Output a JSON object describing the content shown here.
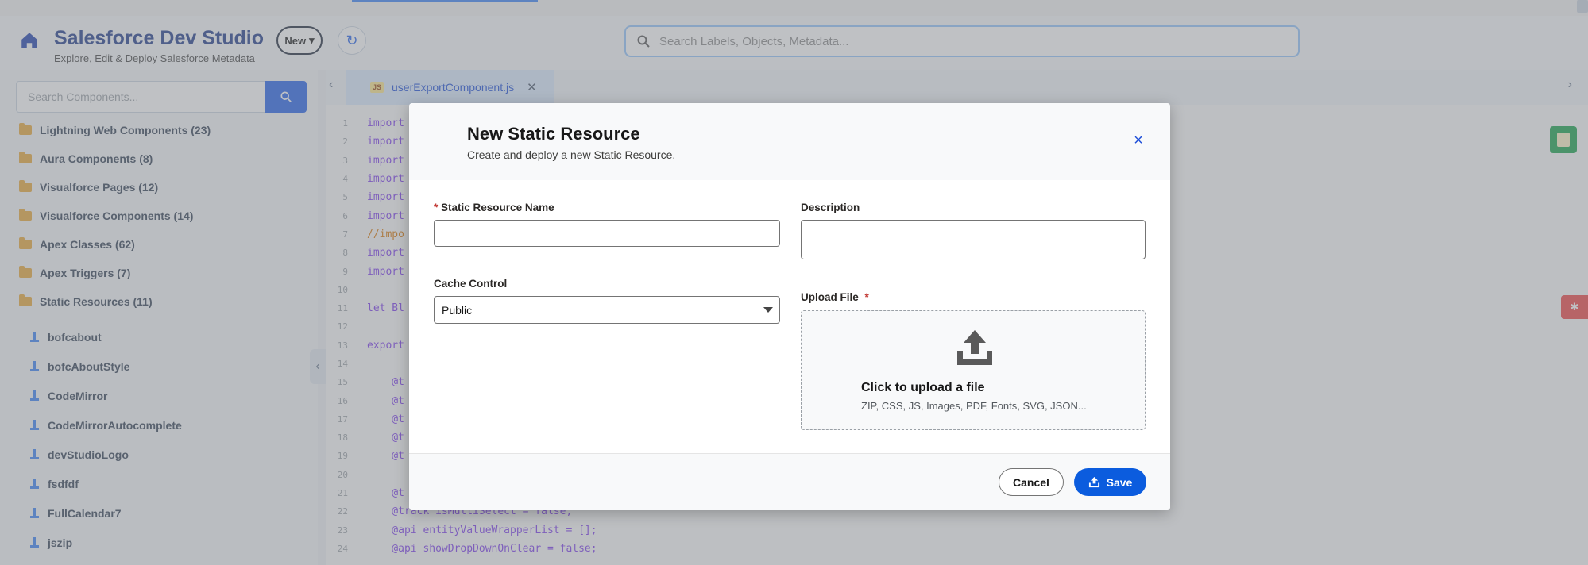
{
  "app": {
    "title": "Salesforce Dev Studio",
    "subtitle": "Explore, Edit & Deploy Salesforce Metadata",
    "new_label": "New",
    "global_search_placeholder": "Search Labels, Objects, Metadata..."
  },
  "sidebar": {
    "search_placeholder": "Search Components...",
    "folders": [
      {
        "label": "Lightning Web Components (23)"
      },
      {
        "label": "Aura Components (8)"
      },
      {
        "label": "Visualforce Pages (12)"
      },
      {
        "label": "Visualforce Components (14)"
      },
      {
        "label": "Apex Classes (62)"
      },
      {
        "label": "Apex Triggers (7)"
      },
      {
        "label": "Static Resources (11)"
      }
    ],
    "resources": [
      {
        "label": "bofcabout"
      },
      {
        "label": "bofcAboutStyle"
      },
      {
        "label": "CodeMirror"
      },
      {
        "label": "CodeMirrorAutocomplete"
      },
      {
        "label": "devStudioLogo"
      },
      {
        "label": "fsdfdf"
      },
      {
        "label": "FullCalendar7"
      },
      {
        "label": "jszip"
      }
    ]
  },
  "editor": {
    "tab_badge": "JS",
    "tab_label": "userExportComponent.js",
    "lines": [
      {
        "n": "1",
        "text": "import"
      },
      {
        "n": "2",
        "text": "import"
      },
      {
        "n": "3",
        "text": "import"
      },
      {
        "n": "4",
        "text": "import"
      },
      {
        "n": "5",
        "text": "import"
      },
      {
        "n": "6",
        "text": "import"
      },
      {
        "n": "7",
        "text": "//impo"
      },
      {
        "n": "8",
        "text": "import"
      },
      {
        "n": "9",
        "text": "import"
      },
      {
        "n": "10",
        "text": ""
      },
      {
        "n": "11",
        "text": "let Bl"
      },
      {
        "n": "12",
        "text": ""
      },
      {
        "n": "13",
        "text": "export"
      },
      {
        "n": "14",
        "text": ""
      },
      {
        "n": "15",
        "text": "    @t"
      },
      {
        "n": "16",
        "text": "    @t"
      },
      {
        "n": "17",
        "text": "    @t"
      },
      {
        "n": "18",
        "text": "    @t"
      },
      {
        "n": "19",
        "text": "    @t"
      },
      {
        "n": "20",
        "text": ""
      },
      {
        "n": "21",
        "text": "    @t"
      },
      {
        "n": "22",
        "text": "    @track isMultiSelect = false;"
      },
      {
        "n": "23",
        "text": "    @api entityValueWrapperList = [];"
      },
      {
        "n": "24",
        "text": "    @api showDropDownOnClear = false;"
      }
    ]
  },
  "modal": {
    "title": "New Static Resource",
    "subtitle": "Create and deploy a new Static Resource.",
    "name_label": "Static Resource Name",
    "name_value": "",
    "description_label": "Description",
    "description_value": "",
    "cache_label": "Cache Control",
    "cache_value": "Public",
    "upload_label": "Upload File",
    "upload_title": "Click to upload a file",
    "upload_hint": "ZIP, CSS, JS, Images, PDF, Fonts, SVG, JSON...",
    "cancel_label": "Cancel",
    "save_label": "Save",
    "required_mark": "*",
    "close_glyph": "×"
  },
  "colors": {
    "primary": "#0b5cde",
    "required": "#c23934"
  }
}
